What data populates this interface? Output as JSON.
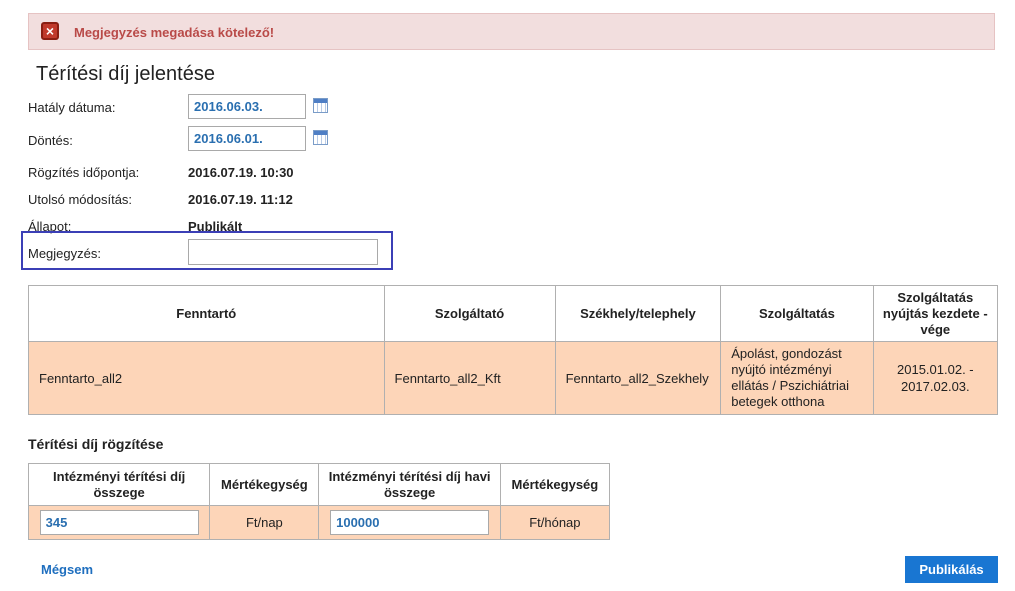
{
  "error": {
    "message": "Megjegyzés megadása kötelező!",
    "icon": "error-x-icon"
  },
  "page": {
    "title": "Térítési díj jelentése"
  },
  "form": {
    "effective_date_label": "Hatály dátuma:",
    "effective_date_value": "2016.06.03.",
    "decision_label": "Döntés:",
    "decision_value": "2016.06.01.",
    "recorded_label": "Rögzítés időpontja:",
    "recorded_value": "2016.07.19. 10:30",
    "modified_label": "Utolsó módosítás:",
    "modified_value": "2016.07.19. 11:12",
    "status_label": "Állapot:",
    "status_value": "Publikált",
    "note_label": "Megjegyzés:",
    "note_value": ""
  },
  "main_table": {
    "headers": [
      "Fenntartó",
      "Szolgáltató",
      "Székhely/telephely",
      "Szolgáltatás",
      "Szolgáltatás nyújtás kezdete - vége"
    ],
    "row": [
      "Fenntarto_all2",
      "Fenntarto_all2_Kft",
      "Fenntarto_all2_Szekhely",
      "Ápolást, gondozást nyújtó intézményi ellátás / Pszichiátriai betegek otthona",
      "2015.01.02. - 2017.02.03."
    ]
  },
  "fee_section": {
    "title": "Térítési díj rögzítése",
    "headers": [
      "Intézményi térítési díj összege",
      "Mértékegység",
      "Intézményi térítési díj havi összege",
      "Mértékegység"
    ],
    "fee_value": "345",
    "fee_unit": "Ft/nap",
    "monthly_value": "100000",
    "monthly_unit": "Ft/hónap"
  },
  "actions": {
    "cancel_label": "Mégsem",
    "publish_label": "Publikálás"
  },
  "colors": {
    "accent": "#1976d2",
    "row_bg": "#fdd5b8",
    "error_bg": "#f2dede",
    "error_text": "#b94a48",
    "highlight": "#3b3fb6"
  }
}
